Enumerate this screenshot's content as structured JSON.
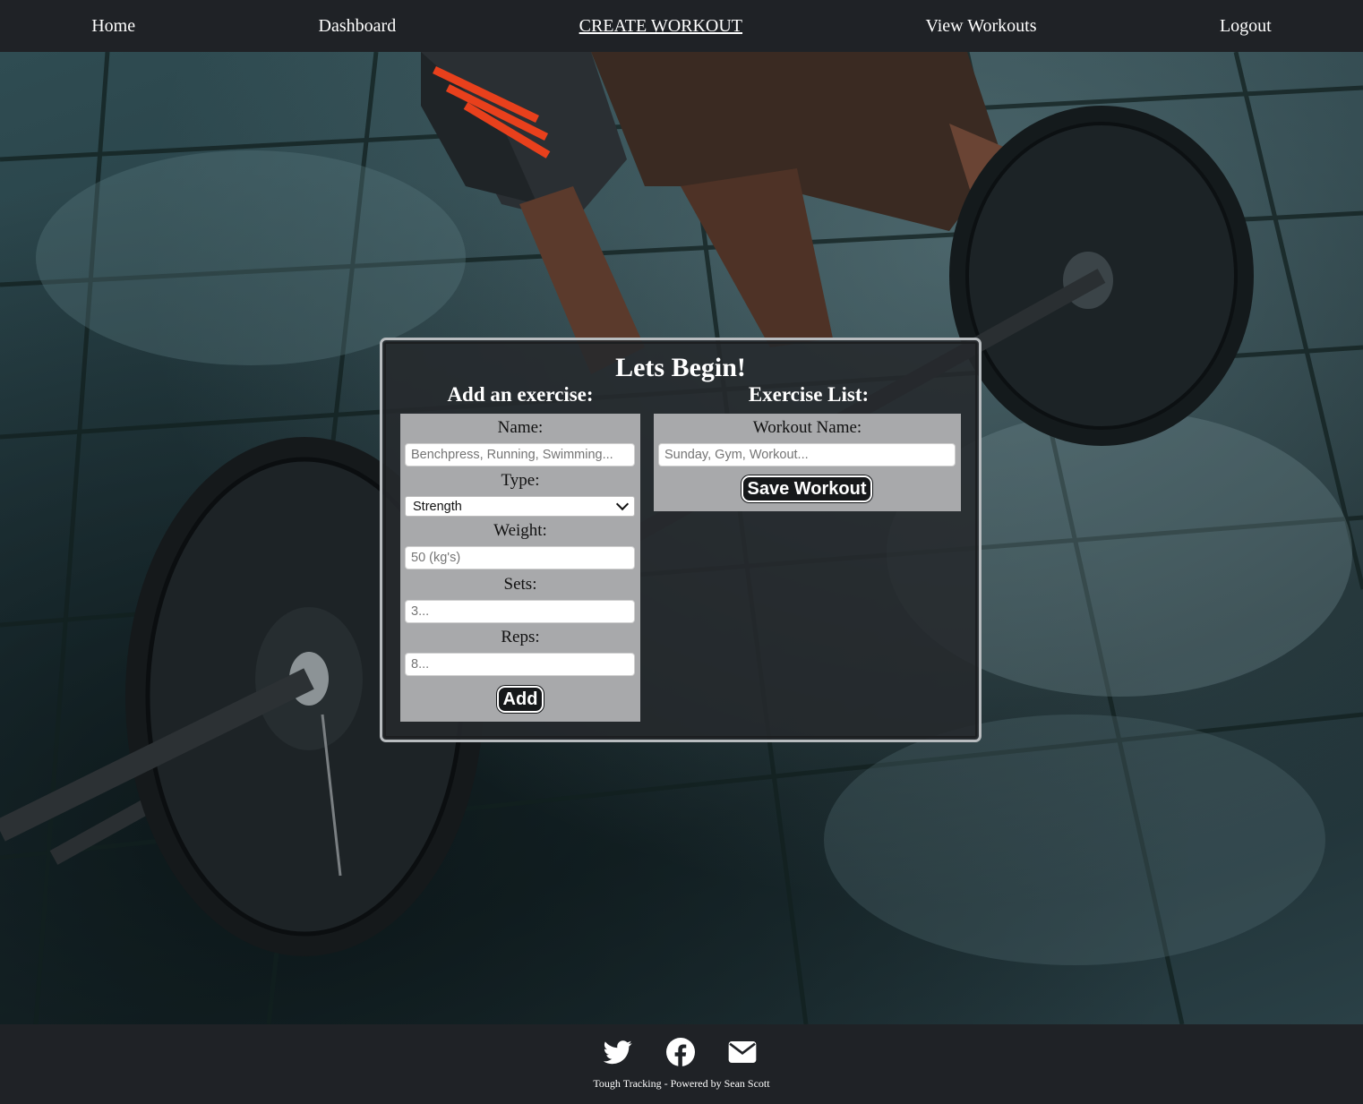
{
  "nav": {
    "home": "Home",
    "dashboard": "Dashboard",
    "create_workout": "CREATE WORKOUT",
    "view_workouts": "View Workouts",
    "logout": "Logout",
    "active": "create_workout"
  },
  "card": {
    "title": "Lets Begin!",
    "left_heading": "Add an exercise:",
    "right_heading": "Exercise List:"
  },
  "exercise_form": {
    "name_label": "Name:",
    "name_placeholder": "Benchpress, Running, Swimming...",
    "type_label": "Type:",
    "type_selected": "Strength",
    "weight_label": "Weight:",
    "weight_placeholder": "50 (kg's)",
    "sets_label": "Sets:",
    "sets_placeholder": "3...",
    "reps_label": "Reps:",
    "reps_placeholder": "8...",
    "add_button": "Add"
  },
  "workout_form": {
    "name_label": "Workout Name:",
    "name_placeholder": "Sunday, Gym, Workout...",
    "save_button": "Save Workout"
  },
  "footer": {
    "icons": [
      "twitter-icon",
      "facebook-icon",
      "mail-icon"
    ],
    "text": "Tough Tracking - Powered by Sean Scott"
  },
  "colors": {
    "nav_bg": "#1f2226",
    "card_bg": "#26292c",
    "panel_bg": "#a8a9ab",
    "button_bg": "#16181a",
    "shorts_accent": "#e8401c"
  }
}
